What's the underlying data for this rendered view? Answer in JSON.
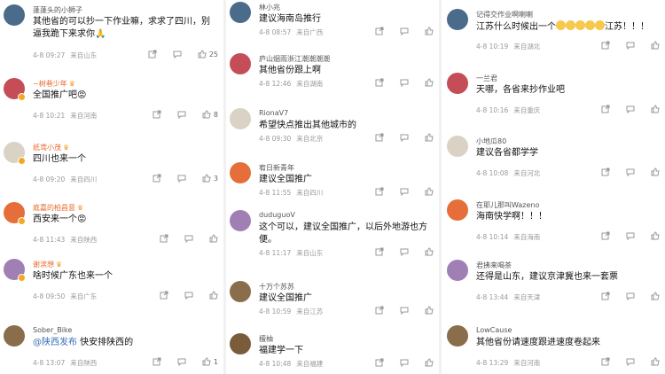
{
  "col1": [
    {
      "user": "蓬蓬头的小狮子",
      "vip": false,
      "text": "其他省的可以抄一下作业嘛，求求了四川，别逼我跪下来求你",
      "emoji_suffix": "🙏",
      "date": "4-8 09:27",
      "loc": "来自山东",
      "likes": "25"
    },
    {
      "user": "~树巷少年",
      "vip": true,
      "text": "全国推广吧",
      "emoji_suffix": "😡",
      "date": "4-8 10:21",
      "loc": "来自河南",
      "likes": "8"
    },
    {
      "user": "纸鸢小茂",
      "vip": true,
      "text": "四川也来一个",
      "emoji_suffix": "",
      "date": "4-8 09:20",
      "loc": "来自四川",
      "likes": "3"
    },
    {
      "user": "庭嘉的柏昌意",
      "vip": true,
      "text": "西安来一个",
      "emoji_suffix": "😡",
      "date": "4-8 11:43",
      "loc": "来自陕西",
      "likes": ""
    },
    {
      "user": "谢滨想",
      "vip": true,
      "text": "啥时候广东也来一个",
      "emoji_suffix": "",
      "date": "4-8 09:50",
      "loc": "来自广东",
      "likes": ""
    },
    {
      "user": "Sober_Bike",
      "vip": false,
      "mention": "@陕西发布",
      "text": " 快安排陕西的",
      "emoji_suffix": "",
      "date": "4-8 13:07",
      "loc": "来自陕西",
      "likes": "1"
    }
  ],
  "col2": [
    {
      "user": "林小兆",
      "text": "建议海南岛推行",
      "date": "4-8 08:57",
      "loc": "来自广西"
    },
    {
      "user": "庐山烟雨浙江潮潮潮潮",
      "text": "其他省份跟上啊",
      "date": "4-8 12:46",
      "loc": "来自湖南"
    },
    {
      "user": "RionaV7",
      "text": "希望快点推出其他城市的",
      "date": "4-8 09:30",
      "loc": "来自北京"
    },
    {
      "user": "宥日新青年",
      "text": "建议全国推广",
      "date": "4-8 11:55",
      "loc": "来自四川"
    },
    {
      "user": "duduguoV",
      "text": "这个可以，建议全国推广，以后外地游也方便。",
      "date": "4-8 11:17",
      "loc": "来自山东"
    },
    {
      "user": "十万个苏苏",
      "text": "建议全国推广",
      "date": "4-8 10:59",
      "loc": "来自江苏"
    },
    {
      "user": "檀柚",
      "text": "福建学一下",
      "date": "4-8 10:48",
      "loc": "来自福建"
    }
  ],
  "col3": [
    {
      "user": "记得交作业啊喇喇",
      "text": "江苏什么时候出一个",
      "emoji_tail": "江苏！！！",
      "date": "4-8 10:19",
      "loc": "来自湖北"
    },
    {
      "user": "一兰君",
      "text": "天哪，各省来抄作业吧",
      "date": "4-8 10:16",
      "loc": "来自重庆"
    },
    {
      "user": "小地瓜80",
      "text": "建议各省都学学",
      "date": "4-8 10:08",
      "loc": "来自河北"
    },
    {
      "user": "在耶儿那叫Wazeno",
      "text": "海南快学啊！！！",
      "date": "4-8 10:14",
      "loc": "来自海南"
    },
    {
      "user": "君拂来喝茶",
      "text": "还得是山东，建议京津冀也来一套票",
      "date": "4-8 13:44",
      "loc": "来自天津"
    },
    {
      "user": "LowCause",
      "text": "其他省份请速度跟进速度卷起来",
      "date": "4-8 13:29",
      "loc": "来自河南"
    }
  ],
  "colors": {
    "vip_name": "#e8692c",
    "mention": "#3b6fb6",
    "meta": "#999999"
  }
}
